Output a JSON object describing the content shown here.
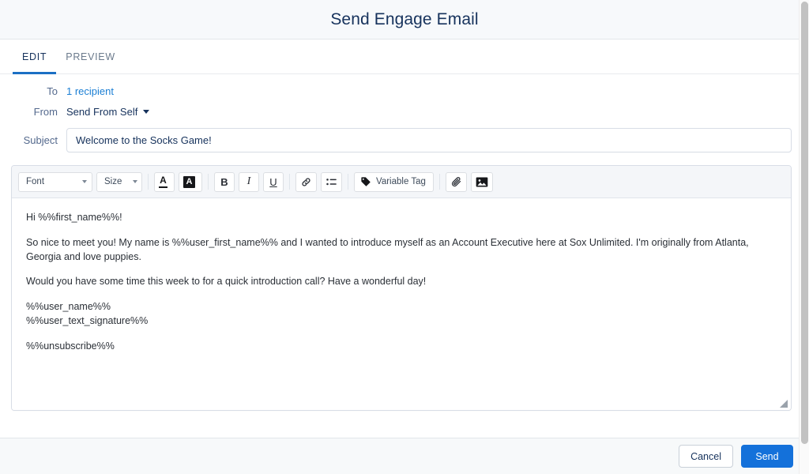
{
  "window": {
    "title": "Send Engage Email"
  },
  "tabs": [
    {
      "label": "EDIT",
      "active": true
    },
    {
      "label": "PREVIEW",
      "active": false
    }
  ],
  "form": {
    "to": {
      "label": "To",
      "value": "1 recipient"
    },
    "from": {
      "label": "From",
      "value": "Send From Self",
      "caret_icon": "chevron-down-icon"
    },
    "subject": {
      "label": "Subject",
      "value": "Welcome to the Socks Game!",
      "placeholder": "Subject"
    }
  },
  "toolbar": {
    "font_select": {
      "label": "Font",
      "caret_icon": "caret-down-icon"
    },
    "size_select": {
      "label": "Size",
      "caret_icon": "caret-down-icon"
    },
    "text_color": {
      "glyph": "A",
      "icon": "text-color-icon"
    },
    "highlight_color": {
      "glyph": "A",
      "icon": "highlight-color-icon"
    },
    "bold": {
      "glyph": "B",
      "icon": "bold-icon"
    },
    "italic": {
      "glyph": "I",
      "icon": "italic-icon"
    },
    "underline": {
      "glyph": "U",
      "icon": "underline-icon"
    },
    "link": {
      "icon": "link-icon"
    },
    "bulleted_list": {
      "icon": "bulleted-list-icon"
    },
    "variable_tag": {
      "label": "Variable Tag",
      "icon": "tag-icon"
    },
    "attachment": {
      "icon": "paperclip-icon"
    },
    "image": {
      "icon": "image-icon"
    }
  },
  "body": {
    "greeting": "Hi %%first_name%%!",
    "paragraph_1": "So nice to meet you! My name is %%user_first_name%% and I wanted to introduce myself as an Account Executive here at Sox Unlimited. I'm originally from Atlanta, Georgia and love puppies.",
    "paragraph_2": "Would you have some time this week to for a quick introduction call? Have a wonderful day!",
    "signature_name": "%%user_name%%",
    "signature_text": "%%user_text_signature%%",
    "unsubscribe": "%%unsubscribe%%"
  },
  "footer": {
    "cancel_label": "Cancel",
    "send_label": "Send"
  },
  "colors": {
    "accent_blue": "#1471da",
    "link_blue": "#1b7fd4",
    "title_navy": "#16325c",
    "tab_underline": "#1b6fc4"
  }
}
